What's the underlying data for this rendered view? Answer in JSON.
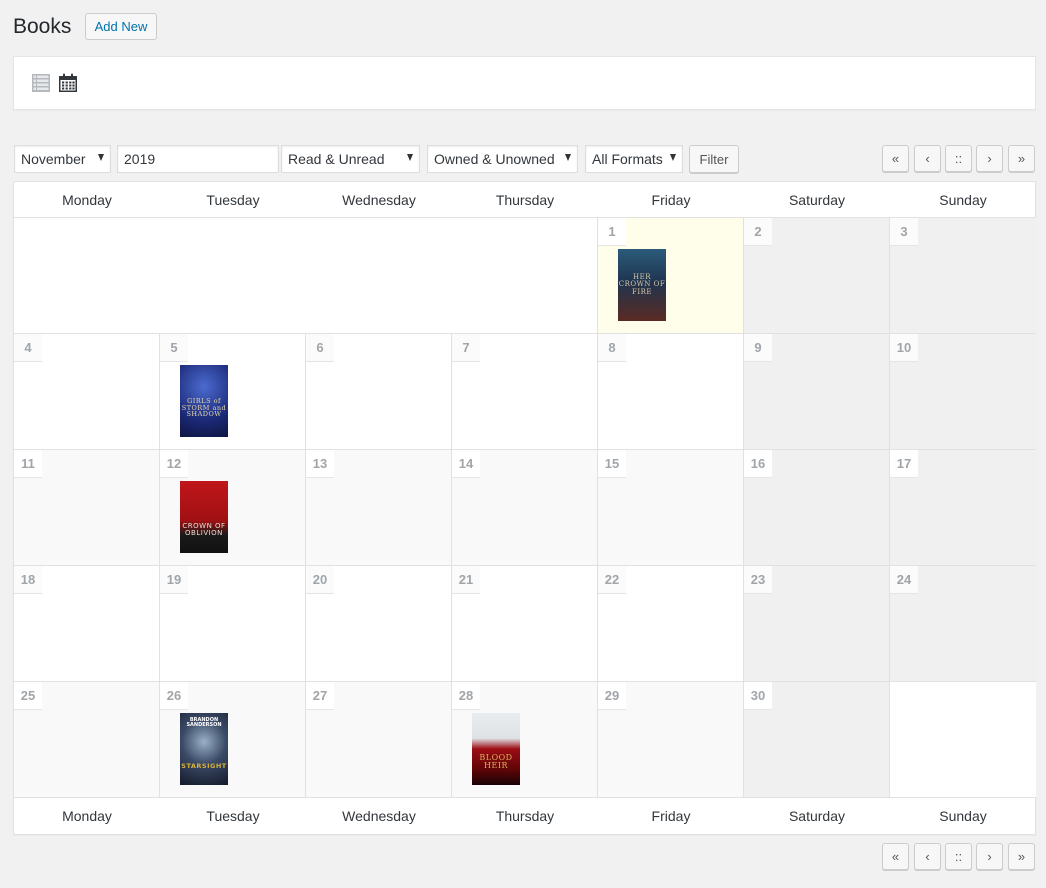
{
  "header": {
    "title": "Books",
    "add_new_label": "Add New"
  },
  "views": {
    "list_icon": "list-view-icon",
    "calendar_icon": "calendar-view-icon",
    "active": "calendar"
  },
  "filters": {
    "month": "November",
    "year": "2019",
    "read_status": "Read & Unread",
    "ownership": "Owned & Unowned",
    "format": "All Formats",
    "filter_button": "Filter"
  },
  "pagination": {
    "first": "«",
    "prev": "‹",
    "current": "::",
    "next": "›",
    "last": "»"
  },
  "calendar": {
    "weekdays": [
      "Monday",
      "Tuesday",
      "Wednesday",
      "Thursday",
      "Friday",
      "Saturday",
      "Sunday"
    ],
    "today": "1",
    "colors": {
      "today": "#fefeea",
      "weekend": "#f0f0f0",
      "alt_row": "#f9f9f9"
    },
    "weeks": [
      {
        "days": [
          "",
          "",
          "",
          "",
          "1",
          "2",
          "3"
        ]
      },
      {
        "days": [
          "4",
          "5",
          "6",
          "7",
          "8",
          "9",
          "10"
        ]
      },
      {
        "days": [
          "11",
          "12",
          "13",
          "14",
          "15",
          "16",
          "17"
        ]
      },
      {
        "days": [
          "18",
          "19",
          "20",
          "21",
          "22",
          "23",
          "24"
        ]
      },
      {
        "days": [
          "25",
          "26",
          "27",
          "28",
          "29",
          "30",
          ""
        ]
      }
    ],
    "books": [
      {
        "day": "1",
        "title": "Her Crown of Fire",
        "cover_text": "HER CROWN OF FIRE"
      },
      {
        "day": "5",
        "title": "Girls of Storm and Shadow",
        "cover_text": "GIRLS of STORM and SHADOW"
      },
      {
        "day": "12",
        "title": "Crown of Oblivion",
        "cover_text": "CROWN OF OBLIVION"
      },
      {
        "day": "26",
        "title": "Starsight",
        "author": "BRANDON SANDERSON",
        "cover_text": "STARSIGHT"
      },
      {
        "day": "28",
        "title": "Blood Heir",
        "cover_text": "BLOOD HEIR"
      }
    ]
  }
}
